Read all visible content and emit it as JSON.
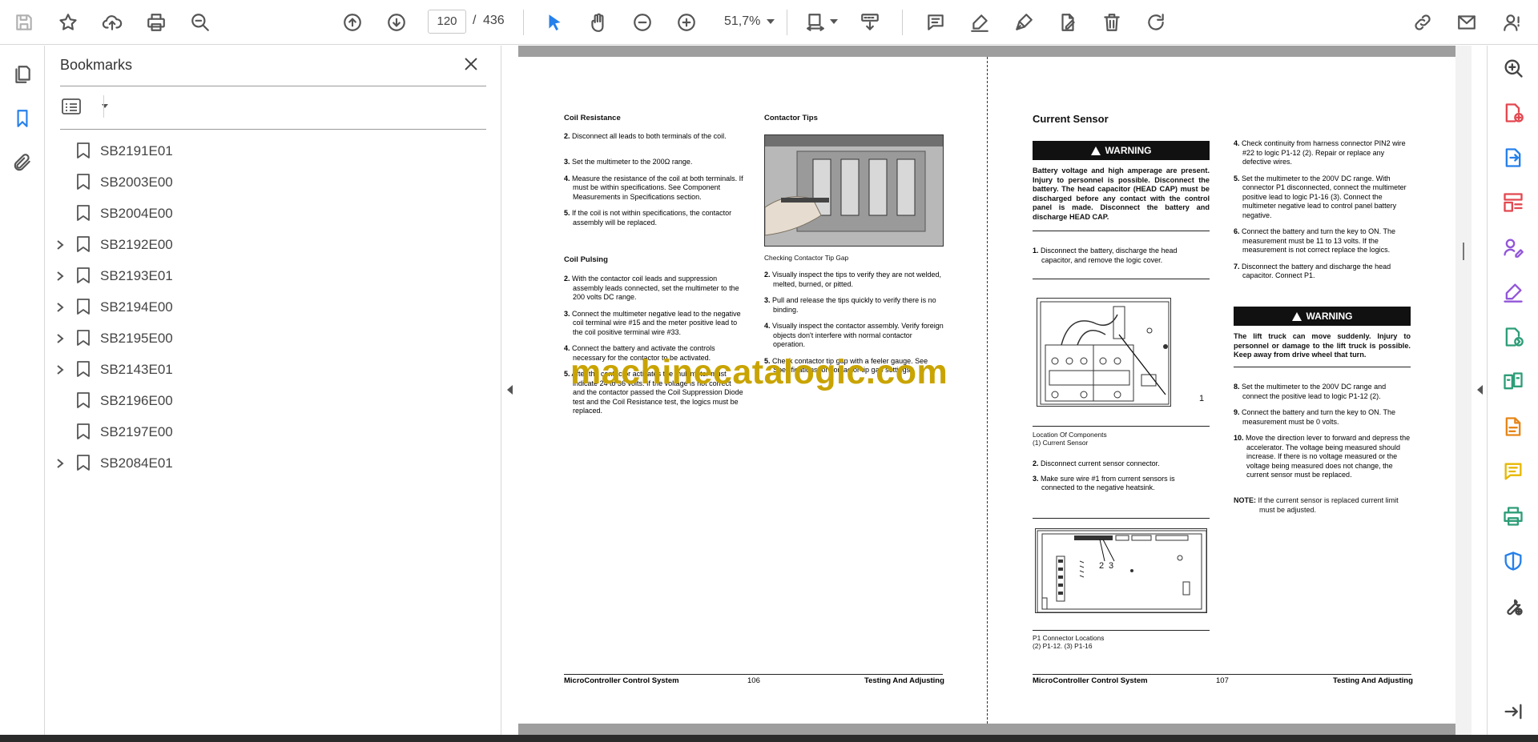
{
  "toolbar": {
    "current_page": "120",
    "page_separator": "/",
    "total_pages": "436",
    "zoom": "51,7%"
  },
  "bookmarks_panel": {
    "title": "Bookmarks",
    "items": [
      {
        "label": "SB2191E01",
        "expandable": false
      },
      {
        "label": "SB2003E00",
        "expandable": false
      },
      {
        "label": "SB2004E00",
        "expandable": false
      },
      {
        "label": "SB2192E00",
        "expandable": true
      },
      {
        "label": "SB2193E01",
        "expandable": true
      },
      {
        "label": "SB2194E00",
        "expandable": true
      },
      {
        "label": "SB2195E00",
        "expandable": true
      },
      {
        "label": "SB2143E01",
        "expandable": true
      },
      {
        "label": "SB2196E00",
        "expandable": false
      },
      {
        "label": "SB2197E00",
        "expandable": false
      },
      {
        "label": "SB2084E01",
        "expandable": true
      }
    ]
  },
  "accent_color": "#2680eb",
  "watermark": "machinecatalogic.com",
  "left_page": {
    "coil_resistance": {
      "heading": "Coil Resistance",
      "steps": [
        {
          "n": "2.",
          "text": "Disconnect all leads to both terminals of the coil."
        },
        {
          "n": "3.",
          "text": "Set the multimeter to the 200Ω range."
        },
        {
          "n": "4.",
          "text": "Measure the resistance of the coil at both terminals. If must be within specifications. See Component Measurements in Specifications section."
        },
        {
          "n": "5.",
          "text": "If the coil is not within specifications, the contactor assembly will be replaced."
        }
      ]
    },
    "coil_pulsing": {
      "heading": "Coil Pulsing",
      "steps": [
        {
          "n": "2.",
          "text": "With the contactor coil leads and suppression assembly leads connected, set the multimeter to the 200 volts DC range."
        },
        {
          "n": "3.",
          "text": "Connect the multimeter negative lead to the negative coil terminal wire #15 and the meter positive lead to the coil positive terminal wire #33."
        },
        {
          "n": "4.",
          "text": "Connect the battery and activate the controls necessary for the contactor to be activated."
        },
        {
          "n": "5.",
          "text": "After the contactor activates the multimeter must indicate 24 to 36 volts. If the voltage is not correct and the contactor passed the Coil Suppression Diode test and the Coil Resistance test, the logics must be replaced."
        }
      ]
    },
    "contactor_tips": {
      "heading": "Contactor Tips",
      "photo_caption": "Checking Contactor Tip Gap",
      "steps": [
        {
          "n": "2.",
          "text": "Visually inspect the tips to verify they are not welded, melted, burned, or pitted."
        },
        {
          "n": "3.",
          "text": "Pull and release the tips quickly to verify there is no binding."
        },
        {
          "n": "4.",
          "text": "Visually inspect the contactor assembly. Verify foreign objects don't interfere with normal contactor operation."
        },
        {
          "n": "5.",
          "text": "Check contactor tip gap with a feeler gauge. See Specifications for contactor tip gap settings."
        }
      ]
    },
    "footer": {
      "left": "MicroController Control System",
      "num": "106",
      "right": "Testing And Adjusting"
    }
  },
  "right_page": {
    "heading": "Current Sensor",
    "warning_label": "WARNING",
    "warning1": "Battery voltage and high amperage are present. Injury to personnel is possible. Disconnect the battery. The head capacitor (HEAD CAP) must be discharged before any contact with the control panel is made. Disconnect the battery and discharge HEAD CAP.",
    "step1": {
      "n": "1.",
      "text": "Disconnect the battery, discharge the head capacitor, and remove the logic cover."
    },
    "figure1_callout": "1",
    "figure1_caption_line1": "Location Of Components",
    "figure1_caption_line2": "(1) Current Sensor",
    "steps_a": [
      {
        "n": "2.",
        "text": "Disconnect current sensor connector."
      },
      {
        "n": "3.",
        "text": "Make sure wire #1 from current sensors is connected to the negative heatsink."
      }
    ],
    "figure2_callout_a": "2",
    "figure2_callout_b": "3",
    "figure2_caption_line1": "P1 Connector Locations",
    "figure2_caption_line2": "(2) P1-12. (3) P1-16",
    "steps_b": [
      {
        "n": "4.",
        "text": "Check continuity from harness connector PIN2 wire #22 to logic P1-12 (2). Repair or replace any defective wires."
      },
      {
        "n": "5.",
        "text": "Set the multimeter to the 200V DC range. With connector P1 disconnected, connect the multimeter positive lead to logic P1-16 (3). Connect the multimeter negative lead to control panel battery negative."
      },
      {
        "n": "6.",
        "text": "Connect the battery and turn the key to ON. The measurement must be 11 to 13 volts. If the measurement is not correct replace the logics."
      },
      {
        "n": "7.",
        "text": "Disconnect the battery and discharge the head capacitor. Connect P1."
      }
    ],
    "warning2": "The lift truck can move suddenly. Injury to personnel or damage to the lift truck is possible. Keep away from drive wheel that turn.",
    "steps_c": [
      {
        "n": "8.",
        "text": "Set the multimeter to the 200V DC range and connect the positive lead to logic P1-12 (2)."
      },
      {
        "n": "9.",
        "text": "Connect the battery and turn the key to ON. The measurement must be 0 volts."
      },
      {
        "n": "10.",
        "text": "Move the direction lever to forward and depress the accelerator. The voltage being measured should increase. If there is no voltage measured or the voltage being measured does not change, the current sensor must be replaced."
      }
    ],
    "note_label": "NOTE:",
    "note_text": "If the current sensor is replaced current limit must be adjusted.",
    "footer": {
      "left": "MicroController Control System",
      "num": "107",
      "right": "Testing And Adjusting"
    }
  }
}
